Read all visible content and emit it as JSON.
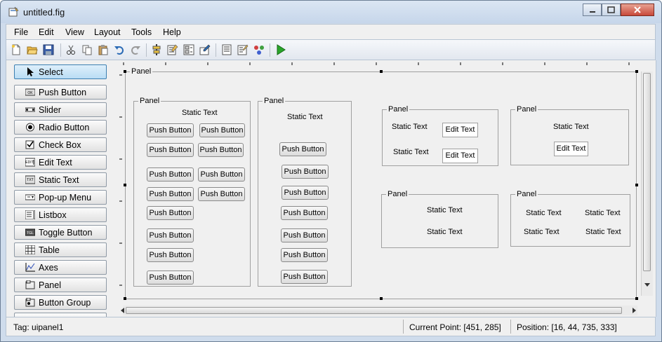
{
  "window": {
    "title": "untitled.fig"
  },
  "menu": [
    "File",
    "Edit",
    "View",
    "Layout",
    "Tools",
    "Help"
  ],
  "toolbar": {
    "icons": [
      "new-file-icon",
      "open-folder-icon",
      "save-icon",
      "cut-icon",
      "copy-icon",
      "paste-icon",
      "undo-icon",
      "redo-icon",
      "align-objects-icon",
      "menu-editor-icon",
      "tab-order-editor-icon",
      "toolbar-editor-icon",
      "mfile-editor-icon",
      "property-inspector-icon",
      "object-browser-icon",
      "run-figure-icon"
    ]
  },
  "palette": [
    {
      "label": "Select",
      "icon": "pointer-icon"
    },
    {
      "label": "Push Button",
      "icon": "push-button-icon"
    },
    {
      "label": "Slider",
      "icon": "slider-icon"
    },
    {
      "label": "Radio Button",
      "icon": "radio-button-icon"
    },
    {
      "label": "Check Box",
      "icon": "check-box-icon"
    },
    {
      "label": "Edit Text",
      "icon": "edit-text-icon"
    },
    {
      "label": "Static Text",
      "icon": "static-text-icon"
    },
    {
      "label": "Pop-up Menu",
      "icon": "popup-menu-icon"
    },
    {
      "label": "Listbox",
      "icon": "listbox-icon"
    },
    {
      "label": "Toggle Button",
      "icon": "toggle-button-icon"
    },
    {
      "label": "Table",
      "icon": "table-icon"
    },
    {
      "label": "Axes",
      "icon": "axes-icon"
    },
    {
      "label": "Panel",
      "icon": "panel-icon"
    },
    {
      "label": "Button Group",
      "icon": "button-group-icon"
    }
  ],
  "canvas": {
    "outer_panel": "Panel",
    "panel1": {
      "title": "Panel",
      "static_text": "Static Text",
      "buttons": [
        "Push Button",
        "Push Button",
        "Push Button",
        "Push Button",
        "Push Button",
        "Push Button",
        "Push Button",
        "Push Button",
        "Push Button",
        "Push Button",
        "Push Button",
        "Push Button"
      ]
    },
    "panel2": {
      "title": "Panel",
      "static_text": "Static Text",
      "buttons": [
        "Push Button",
        "Push Button",
        "Push Button",
        "Push Button",
        "Push Button",
        "Push Button",
        "Push Button"
      ]
    },
    "panel3": {
      "title": "Panel",
      "static_texts": [
        "Static Text",
        "Static Text"
      ],
      "edit_texts": [
        "Edit Text",
        "Edit Text"
      ]
    },
    "panel4": {
      "title": "Panel",
      "static_text": "Static Text",
      "edit_text": "Edit Text"
    },
    "panel5": {
      "title": "Panel",
      "static_texts": [
        "Static Text",
        "Static Text"
      ]
    },
    "panel6": {
      "title": "Panel",
      "static_texts": [
        "Static Text",
        "Static Text",
        "Static Text",
        "Static Text"
      ]
    }
  },
  "status": {
    "tag": "Tag: uipanel1",
    "current_point": "Current Point:  [451, 285]",
    "position": "Position: [16, 44, 735, 333]"
  }
}
